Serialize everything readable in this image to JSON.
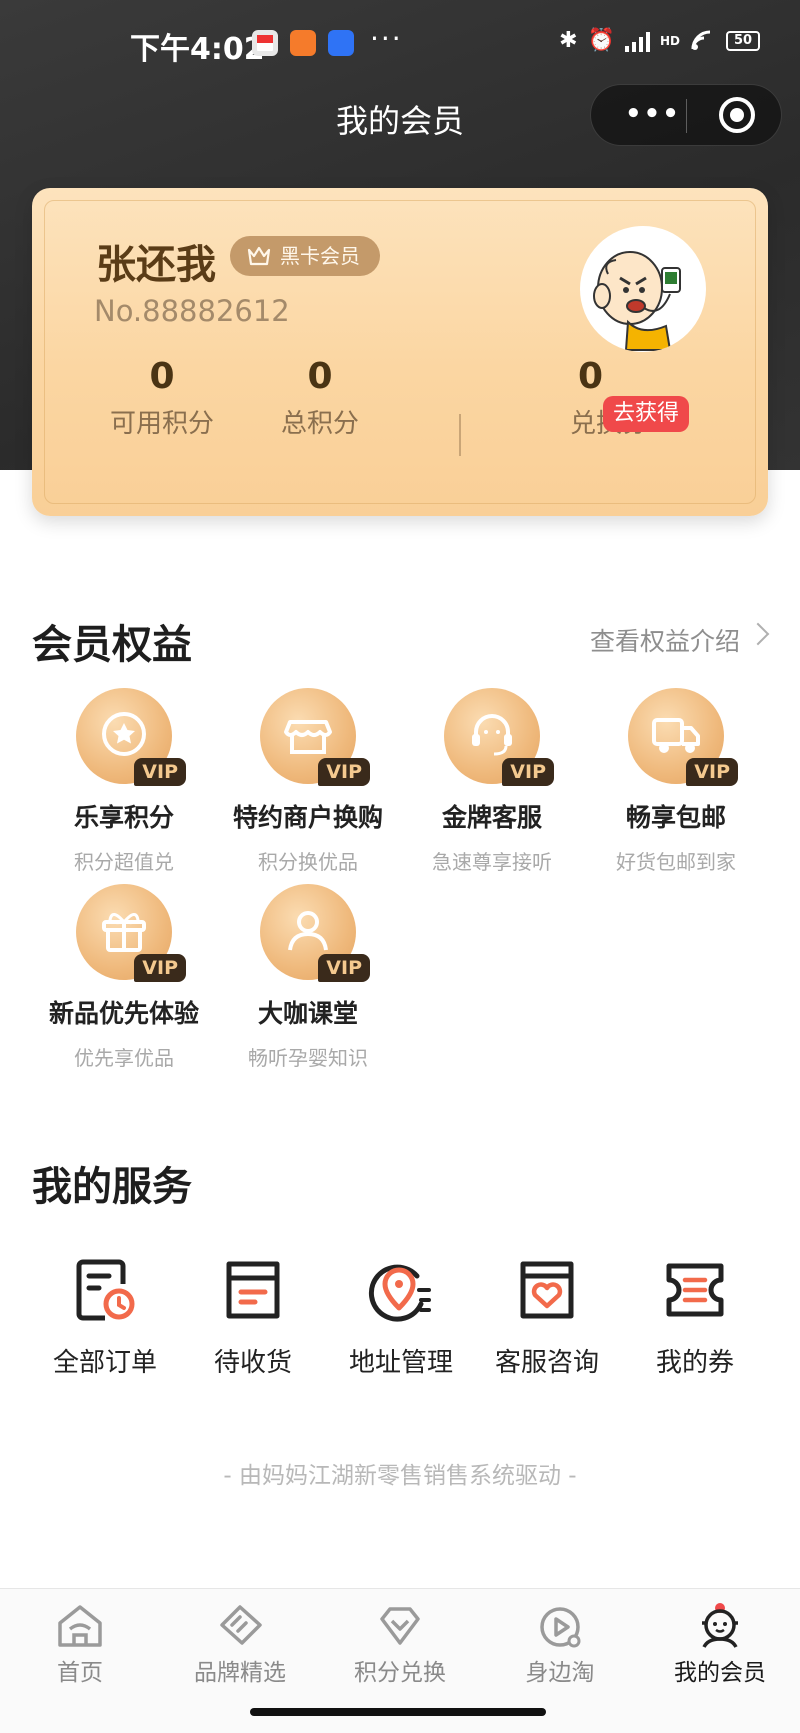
{
  "status_bar": {
    "time": "下午4:02",
    "more": "···",
    "network_label": "HD",
    "battery": "50"
  },
  "nav": {
    "title": "我的会员",
    "menu_icon": "more-dots-icon",
    "close_icon": "target-icon"
  },
  "member_card": {
    "name": "张还我",
    "badge": "黑卡会员",
    "number": "No.88882612",
    "stats": {
      "available_points": {
        "value": "0",
        "label": "可用积分"
      },
      "total_points": {
        "value": "0",
        "label": "总积分"
      },
      "coupons": {
        "value": "0",
        "label": "兑换券",
        "action": "去获得"
      }
    }
  },
  "benefits": {
    "title": "会员权益",
    "link": "查看权益介绍",
    "vip_tag": "VIP",
    "items": [
      {
        "title": "乐享积分",
        "subtitle": "积分超值兑",
        "icon": "star-coin-icon"
      },
      {
        "title": "特约商户换购",
        "subtitle": "积分换优品",
        "icon": "store-icon"
      },
      {
        "title": "金牌客服",
        "subtitle": "急速尊享接听",
        "icon": "headset-icon"
      },
      {
        "title": "畅享包邮",
        "subtitle": "好货包邮到家",
        "icon": "truck-icon"
      },
      {
        "title": "新品优先体验",
        "subtitle": "优先享优品",
        "icon": "gift-icon"
      },
      {
        "title": "大咖课堂",
        "subtitle": "畅听孕婴知识",
        "icon": "person-icon"
      }
    ]
  },
  "services": {
    "title": "我的服务",
    "items": [
      {
        "label": "全部订单",
        "icon": "order-list-icon"
      },
      {
        "label": "待收货",
        "icon": "package-box-icon"
      },
      {
        "label": "地址管理",
        "icon": "location-pin-icon"
      },
      {
        "label": "客服咨询",
        "icon": "heart-bag-icon"
      },
      {
        "label": "我的券",
        "icon": "coupon-ticket-icon"
      }
    ]
  },
  "footer_note": "- 由妈妈江湖新零售销售系统驱动 -",
  "tabbar": {
    "items": [
      {
        "label": "首页",
        "icon": "home-icon",
        "active": false
      },
      {
        "label": "品牌精选",
        "icon": "brand-tag-icon",
        "active": false
      },
      {
        "label": "积分兑换",
        "icon": "diamond-icon",
        "active": false
      },
      {
        "label": "身边淘",
        "icon": "nearby-play-icon",
        "active": false
      },
      {
        "label": "我的会员",
        "icon": "baby-face-icon",
        "active": true
      }
    ]
  },
  "colors": {
    "accent_red": "#f0494a",
    "service_orange": "#f26a4b",
    "card_gold": "#fbd6a2",
    "dark_header": "#2f2f2f"
  }
}
